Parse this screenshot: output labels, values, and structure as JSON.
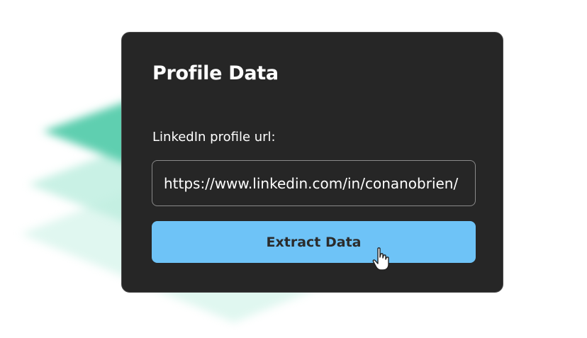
{
  "card": {
    "title": "Profile Data",
    "field_label": "LinkedIn profile url:",
    "url_value": "https://www.linkedin.com/in/conanobrien/",
    "button_label": "Extract Data"
  },
  "colors": {
    "card_bg": "#262626",
    "button_bg": "#6ec3f7",
    "backdrop_layers": [
      "#5fcfb0",
      "#bfeee0",
      "#d8f5ec"
    ]
  },
  "icons": [
    "pointer-hand-icon"
  ]
}
